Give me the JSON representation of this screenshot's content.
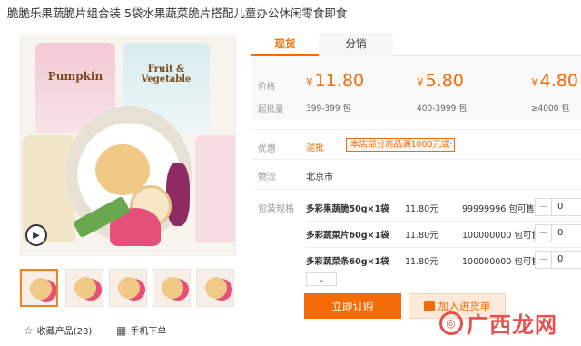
{
  "product": {
    "title": "脆脆乐果蔬脆片组合装 5袋水果蔬菜脆片搭配儿童办公休闲零食即食"
  },
  "gallery": {
    "images": [
      {
        "pouch_text": "Pumpkin"
      },
      {
        "pouch_text": "Fruit & Vegetable"
      }
    ],
    "thumbnail_count": 5,
    "favorite": {
      "label": "收藏产品(28)"
    },
    "mobile_order": {
      "label": "手机下单"
    }
  },
  "tabs": [
    {
      "label": "现货",
      "active": true
    },
    {
      "label": "分销",
      "active": false
    }
  ],
  "pricing": {
    "price_label": "价格",
    "batch_label": "起批量",
    "currency": "¥",
    "tiers": [
      {
        "price": "11.80",
        "qty": "399-399 包"
      },
      {
        "price": "5.80",
        "qty": "400-3999 包"
      },
      {
        "price": "4.80",
        "qty": "≥4000 包"
      }
    ]
  },
  "promotion": {
    "label": "优惠",
    "tag": "混批",
    "text": "本店部分商品满1000元或"
  },
  "logistics": {
    "label": "物流",
    "value": "北京市"
  },
  "skus": {
    "label": "包装规格",
    "items": [
      {
        "name": "多彩果蔬脆50g×1袋",
        "price": "11.80元",
        "stock": "99999996 包可售",
        "quantity": "0"
      },
      {
        "name": "多彩蔬菜片60g×1袋",
        "price": "11.80元",
        "stock": "100000000 包可售",
        "quantity": "0"
      },
      {
        "name": "多彩蔬菜条60g×1袋",
        "price": "11.80元",
        "stock": "100000000 包可售",
        "quantity": "0"
      }
    ]
  },
  "actions": {
    "order_label": "立即订购",
    "cart_label": "加入进货单"
  },
  "watermark": {
    "text": "广西龙网"
  },
  "colors": {
    "accent": "#f56c07",
    "watermark": "#e23c38"
  }
}
